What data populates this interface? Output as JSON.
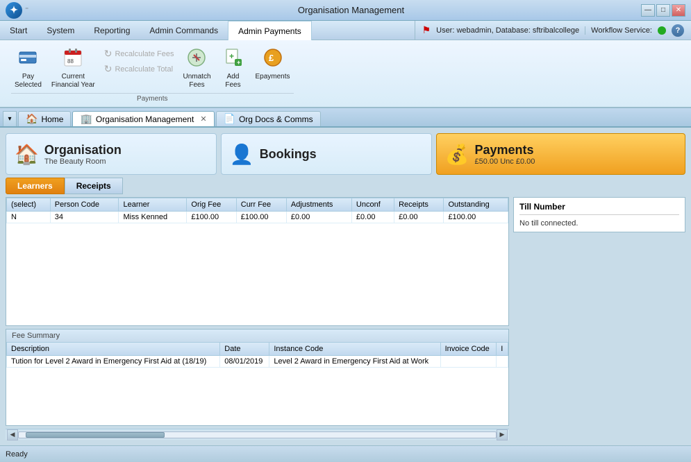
{
  "window": {
    "title": "Organisation Management",
    "minimize": "—",
    "maximize": "□",
    "close": "✕"
  },
  "menubar": {
    "items": [
      "Start",
      "System",
      "Reporting",
      "Admin Commands",
      "Admin Payments"
    ]
  },
  "infobar": {
    "user": "User: webadmin, Database: sftribalcollege",
    "workflow": "Workflow Service:"
  },
  "ribbon": {
    "buttons": [
      {
        "icon": "💳",
        "label": "Pay\nSelected",
        "big": true
      },
      {
        "icon": "📅",
        "label": "Current\nFinancial Year",
        "big": true
      }
    ],
    "small_buttons": [
      {
        "icon": "🔄",
        "label": "Recalculate Fees",
        "disabled": true
      },
      {
        "icon": "🔄",
        "label": "Recalculate Total",
        "disabled": true
      }
    ],
    "more_buttons": [
      {
        "icon": "↩️",
        "label": "Unmatch\nFees",
        "big": true
      },
      {
        "icon": "➕",
        "label": "Add\nFees",
        "big": true
      },
      {
        "icon": "🔶",
        "label": "Epayments",
        "big": true
      }
    ],
    "group_label": "Payments"
  },
  "doc_tabs": [
    {
      "icon": "🏠",
      "label": "Home",
      "closable": false,
      "active": false
    },
    {
      "icon": "🏢",
      "label": "Organisation Management",
      "closable": true,
      "active": true
    },
    {
      "icon": "📄",
      "label": "Org Docs & Comms",
      "closable": false,
      "active": false
    }
  ],
  "org_section": {
    "icon": "🏠",
    "title": "Organisation",
    "subtitle": "The Beauty Room"
  },
  "bookings_section": {
    "icon": "👤",
    "title": "Bookings"
  },
  "payments_section": {
    "icon": "💰",
    "title": "Payments",
    "amount": "£50.00",
    "unconfirmed": "Unc £0.00"
  },
  "sub_tabs": [
    "Learners",
    "Receipts"
  ],
  "table": {
    "headers": [
      "(select)",
      "Person Code",
      "Learner",
      "Orig Fee",
      "Curr Fee",
      "Adjustments",
      "Unconf",
      "Receipts",
      "Outstanding"
    ],
    "rows": [
      {
        "select": "N",
        "person_code": "34",
        "learner": "Miss Kenned",
        "orig_fee": "£100.00",
        "curr_fee": "£100.00",
        "adjustments": "£0.00",
        "unconf": "£0.00",
        "receipts": "£0.00",
        "outstanding": "£100.00"
      }
    ]
  },
  "till": {
    "title": "Till Number",
    "status": "No till connected."
  },
  "fee_summary": {
    "title": "Fee Summary",
    "headers": [
      "Description",
      "Date",
      "Instance Code",
      "Invoice Code",
      "I"
    ],
    "rows": [
      {
        "description": "Tution for Level 2 Award in Emergency First Aid at  (18/19)",
        "date": "08/01/2019",
        "instance_code": "Level 2 Award in Emergency First Aid at Work",
        "invoice_code": "",
        "i": ""
      }
    ]
  },
  "status_bar": {
    "text": "Ready"
  },
  "scroll": {
    "left_arrow": "◀",
    "right_arrow": "▶"
  }
}
